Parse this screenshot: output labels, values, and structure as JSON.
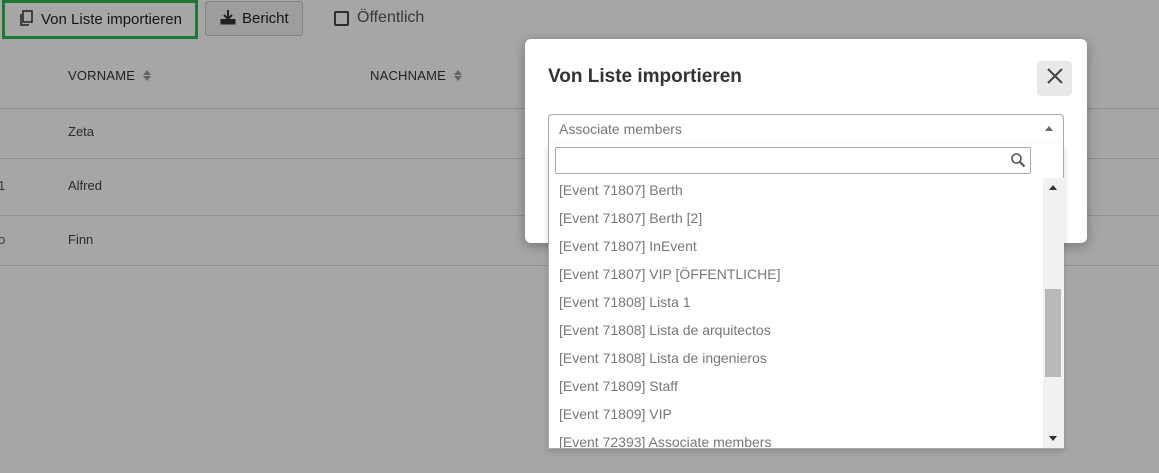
{
  "toolbar": {
    "import_label": "Von Liste importieren",
    "report_label": "Bericht",
    "public_label": "Öffentlich",
    "public_checked": false
  },
  "table": {
    "columns": [
      "VORNAME",
      "NACHNAME"
    ],
    "rows": [
      {
        "edge": "",
        "first_name": "Zeta"
      },
      {
        "edge": "1",
        "first_name": "Alfred"
      },
      {
        "edge": "o",
        "first_name": "Finn"
      }
    ]
  },
  "modal": {
    "title": "Von Liste importieren",
    "select": {
      "selected_value": "Associate members",
      "search_value": "",
      "options": [
        "[Event 71807] Berth",
        "[Event 71807] Berth [2]",
        "[Event 71807] InEvent",
        "[Event 71807] VIP [ÖFFENTLICHE]",
        "[Event 71808] Lista 1",
        "[Event 71808] Lista de arquitectos",
        "[Event 71808] Lista de ingenieros",
        "[Event 71809] Staff",
        "[Event 71809] VIP",
        "[Event 72393] Associate members"
      ]
    }
  },
  "icons": {
    "import": "copy-icon",
    "report": "download-icon",
    "close": "close-icon",
    "search": "search-icon"
  },
  "colors": {
    "highlight": "#2db84d",
    "overlay": "rgba(0,0,0,0.35)"
  }
}
